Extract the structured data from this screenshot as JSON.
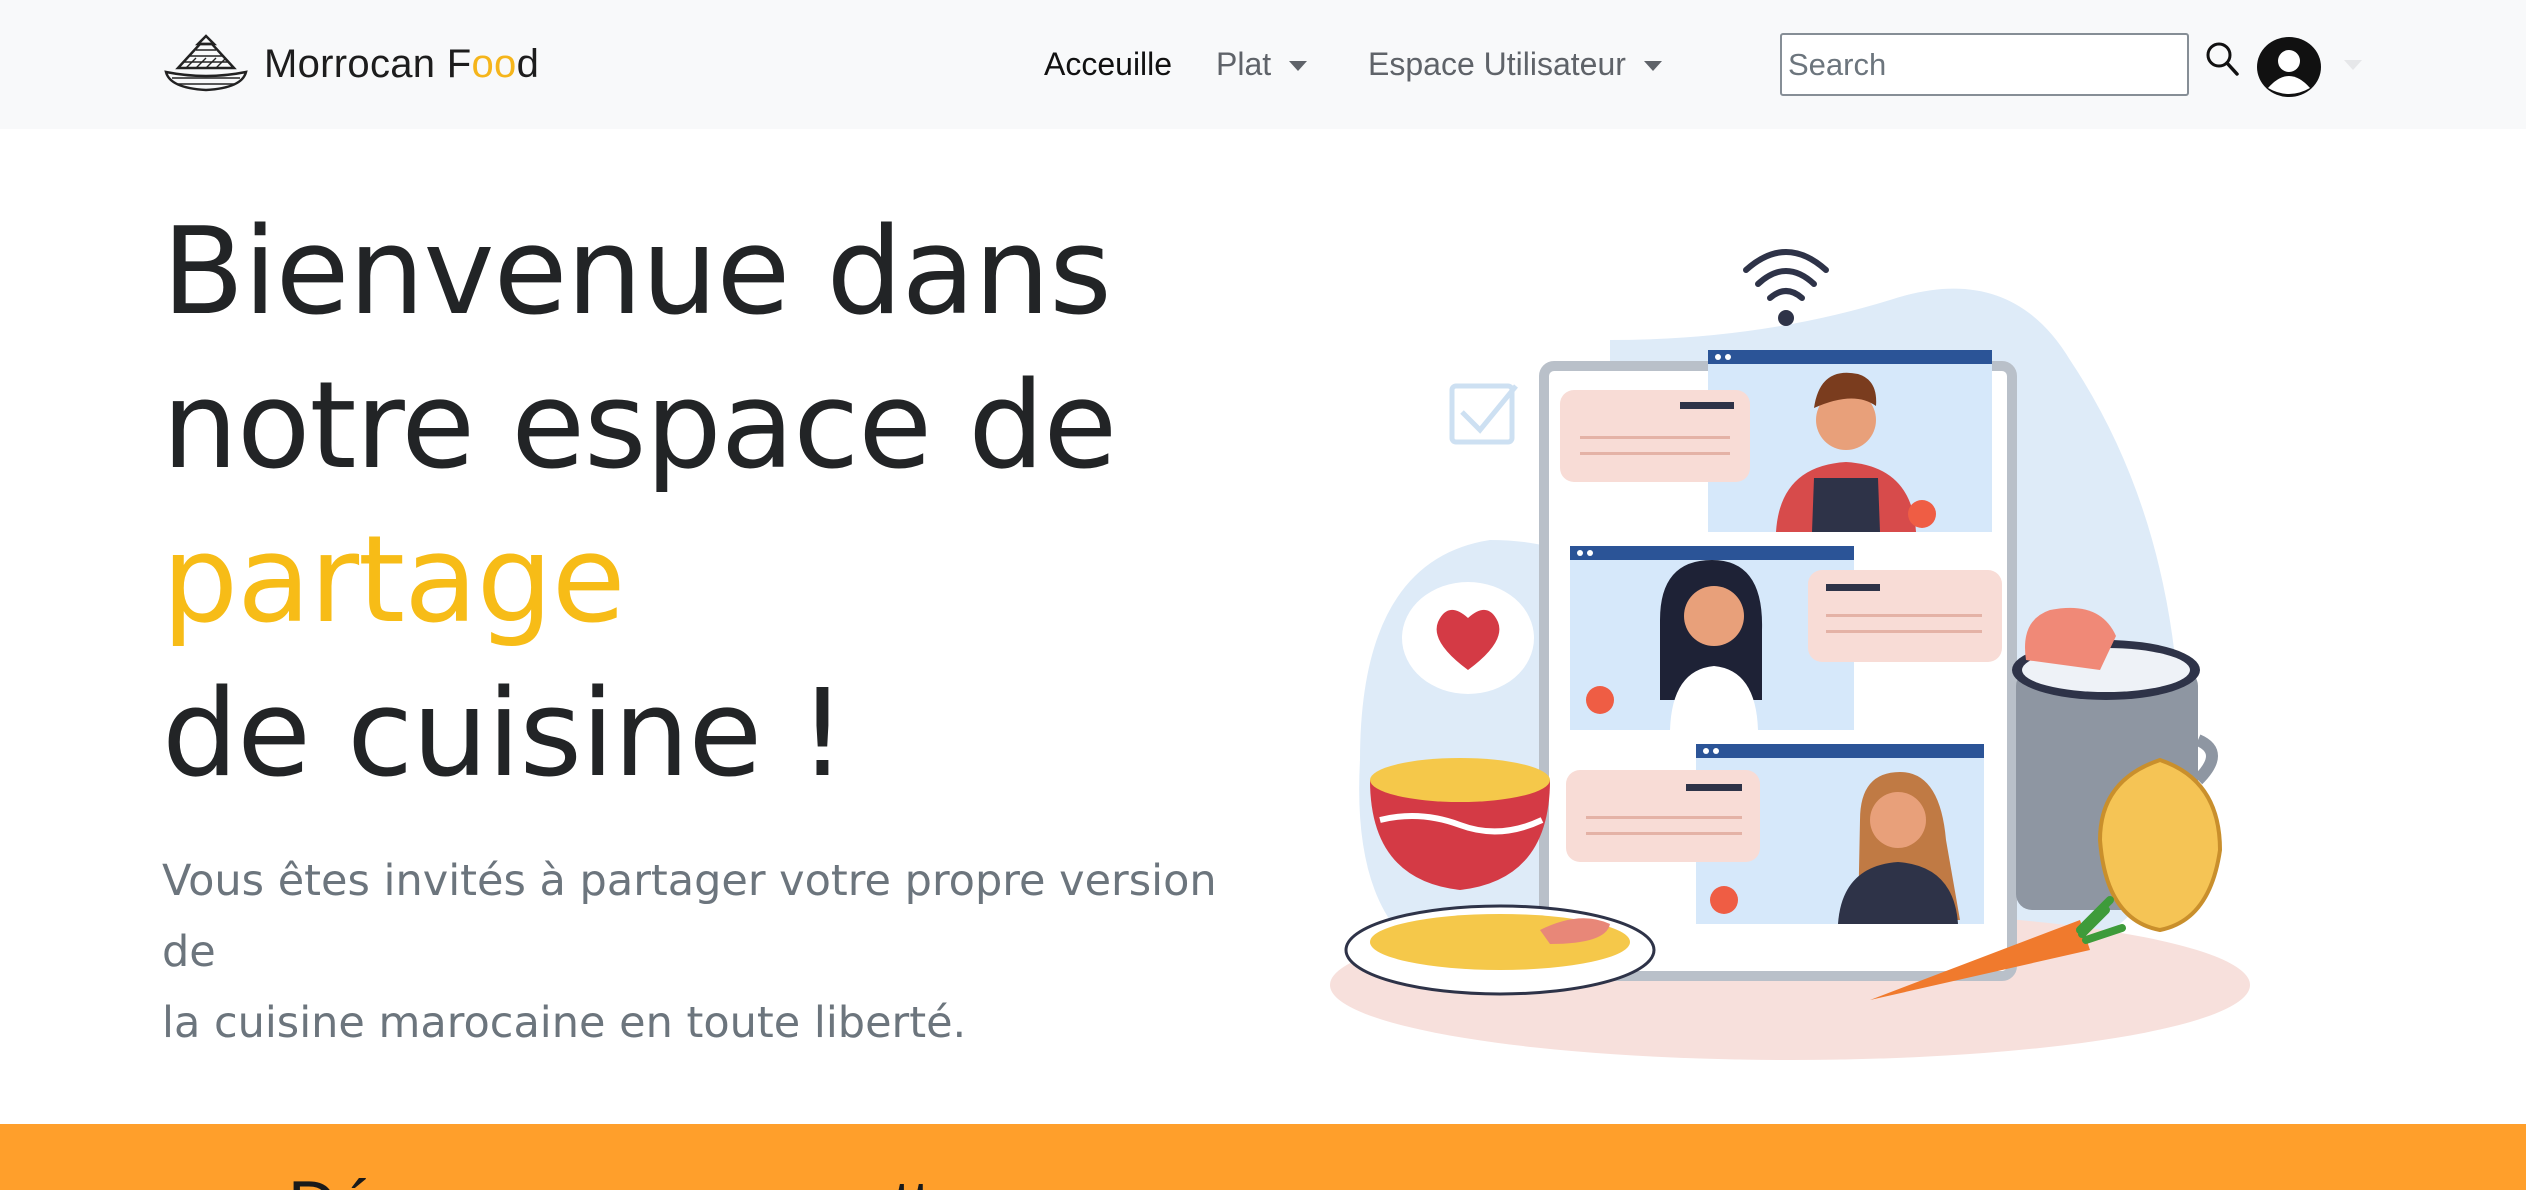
{
  "brand": {
    "name_part1": "Morrocan F",
    "name_accent": "oo",
    "name_part2": "d",
    "logo_icon": "tagine-icon"
  },
  "nav": {
    "items": [
      {
        "label": "Acceuille",
        "active": true,
        "dropdown": false
      },
      {
        "label": "Plat",
        "active": false,
        "dropdown": true
      },
      {
        "label": "Espace Utilisateur",
        "active": false,
        "dropdown": true
      }
    ]
  },
  "search": {
    "placeholder": "Search",
    "value": "",
    "icon": "search-icon"
  },
  "user_menu": {
    "icon": "user-avatar-icon"
  },
  "hero": {
    "title_line1": "Bienvenue dans",
    "title_line2": "notre espace de",
    "title_highlight": "partage",
    "title_line4": "de cuisine !",
    "lead_line1": "Vous êtes invités à partager votre propre version de",
    "lead_line2": "la cuisine marocaine en toute liberté.",
    "illustration": "video-call-cooking-illustration"
  },
  "band": {
    "title": "Découvrez nos recettes"
  },
  "colors": {
    "navbar_bg": "#f8f9fa",
    "accent_yellow": "#f7bc17",
    "band_orange": "#ff9f2b",
    "text_dark": "#222426",
    "text_muted": "#6c757d"
  }
}
